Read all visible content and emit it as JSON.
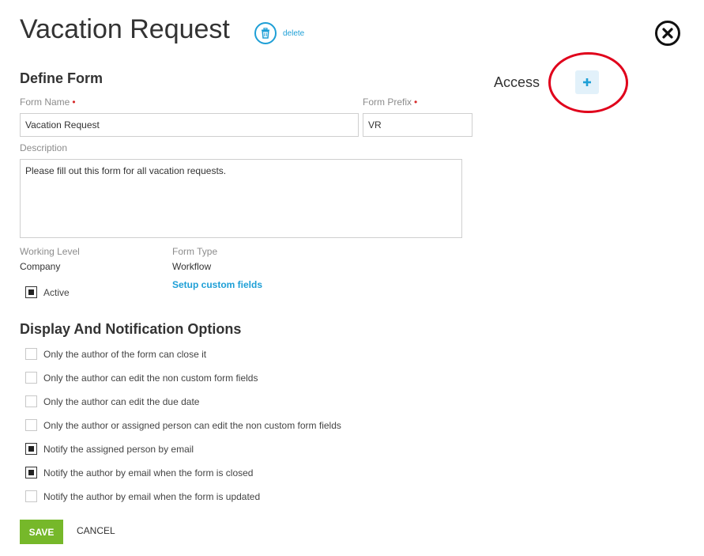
{
  "header": {
    "title": "Vacation Request",
    "delete_label": "delete"
  },
  "define_form": {
    "title": "Define Form",
    "form_name_label": "Form Name",
    "form_name_value": "Vacation Request",
    "form_prefix_label": "Form Prefix",
    "form_prefix_value": "VR",
    "description_label": "Description",
    "description_value": "Please fill out this form for all vacation requests.",
    "working_level_label": "Working Level",
    "working_level_value": "Company",
    "form_type_label": "Form Type",
    "form_type_value": "Workflow",
    "setup_link": "Setup custom fields",
    "active_label": "Active",
    "active_checked": true
  },
  "access": {
    "title": "Access",
    "add_icon": "plus-icon"
  },
  "display_options": {
    "title": "Display And Notification Options",
    "options": [
      {
        "label": "Only the author of the form can close it",
        "checked": false
      },
      {
        "label": "Only the author can edit the non custom form fields",
        "checked": false
      },
      {
        "label": "Only the author can edit the due date",
        "checked": false
      },
      {
        "label": "Only the author or assigned person can edit the non custom form fields",
        "checked": false
      },
      {
        "label": "Notify the assigned person by email",
        "checked": true
      },
      {
        "label": "Notify the author by email when the form is closed",
        "checked": true
      },
      {
        "label": "Notify the author by email when the form is updated",
        "checked": false
      }
    ]
  },
  "actions": {
    "save_label": "SAVE",
    "cancel_label": "CANCEL"
  },
  "colors": {
    "accent": "#1e9fd6",
    "save": "#76b82a",
    "required": "#d62a2a",
    "annotation": "#e0001b"
  },
  "icons": {
    "delete": "trash-icon",
    "close": "close-icon"
  }
}
